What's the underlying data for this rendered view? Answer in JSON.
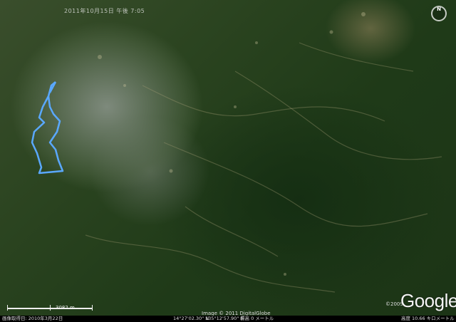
{
  "map": {
    "top_date": "2011年10月15日 午後 7:05",
    "image_credit": "Image © 2011 DigitalGlobe",
    "copyright_year": "©2009",
    "logo": "Google",
    "scale_label": "3082 m",
    "compass_label": "N",
    "compass_icon": "compass-icon"
  },
  "statusbar": {
    "imagery_date": "画像取得日: 2010年3月22日",
    "latitude": "14°27'02.30\" N",
    "longitude": "135°12'57.90\" E",
    "elevation": "標高 0 メートル",
    "eye_alt_label": "高度",
    "eye_alt_value": "10.66 キロメートル"
  },
  "track": {
    "color": "#5aa8ff"
  }
}
